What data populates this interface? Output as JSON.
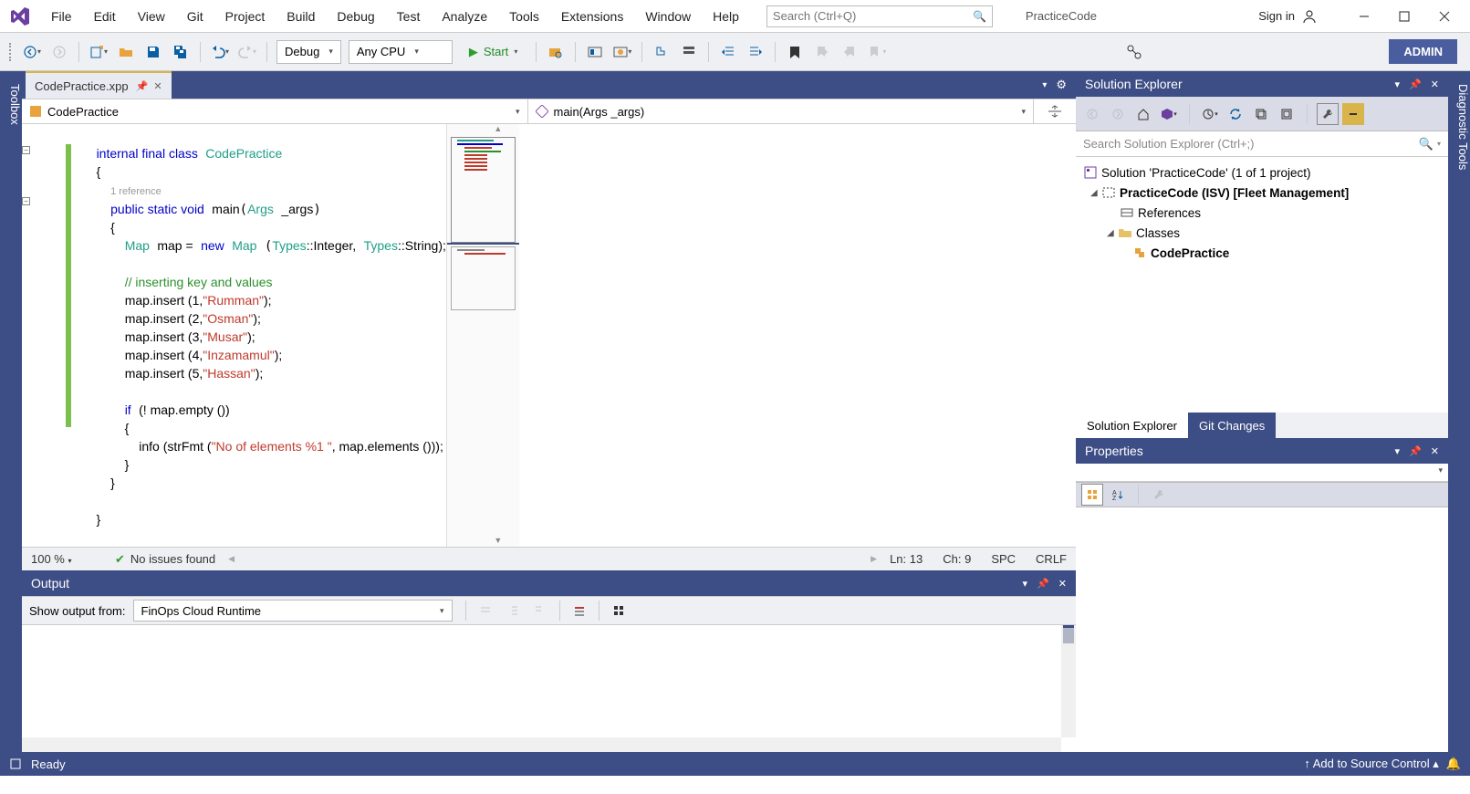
{
  "menu": {
    "items": [
      "File",
      "Edit",
      "View",
      "Git",
      "Project",
      "Build",
      "Debug",
      "Test",
      "Analyze",
      "Tools",
      "Extensions",
      "Window",
      "Help"
    ]
  },
  "search": {
    "placeholder": "Search (Ctrl+Q)"
  },
  "app_title": "PracticeCode",
  "signin": "Sign in",
  "toolbar": {
    "config": "Debug",
    "platform": "Any CPU",
    "start": "Start",
    "admin": "ADMIN"
  },
  "left_rail": "Toolbox",
  "right_rail": "Diagnostic Tools",
  "tab": {
    "name": "CodePractice.xpp"
  },
  "nav": {
    "left": "CodePractice",
    "right": "main(Args _args)"
  },
  "code": {
    "ref_lens": "1 reference",
    "lines": {
      "l1_a": "internal final class",
      "l1_b": "CodePractice",
      "l3_a": "public static void",
      "l3_b": "main",
      "l3_c": "Args",
      "l3_d": "_args",
      "l5_a": "Map",
      "l5_b": "map =",
      "l5_c": "new",
      "l5_d": "Map",
      "l5_e": "Types",
      "l5_f": "::Integer,",
      "l5_g": "Types",
      "l5_h": "::String);",
      "cmt": "// inserting key and values",
      "i1_a": "map.insert (1,",
      "i1_b": "\"Rumman\"",
      "i1_c": ");",
      "i2_a": "map.insert (2,",
      "i2_b": "\"Osman\"",
      "i2_c": ");",
      "i3_a": "map.insert (3,",
      "i3_b": "\"Musar\"",
      "i3_c": ");",
      "i4_a": "map.insert (4,",
      "i4_b": "\"Inzamamul\"",
      "i4_c": ");",
      "i5_a": "map.insert (5,",
      "i5_b": "\"Hassan\"",
      "i5_c": ");",
      "if_a": "if",
      "if_b": "(! map.empty ())",
      "info_a": "info (strFmt (",
      "info_b": "\"No of elements %1 \"",
      "info_c": ", map.elements ()));"
    }
  },
  "code_status": {
    "zoom": "100 %",
    "issues": "No issues found",
    "ln": "Ln: 13",
    "ch": "Ch: 9",
    "ws": "SPC",
    "eol": "CRLF"
  },
  "output": {
    "title": "Output",
    "from_label": "Show output from:",
    "from": "FinOps Cloud Runtime"
  },
  "solution": {
    "title": "Solution Explorer",
    "search_placeholder": "Search Solution Explorer (Ctrl+;)",
    "root": "Solution 'PracticeCode' (1 of 1 project)",
    "project": "PracticeCode (ISV) [Fleet Management]",
    "refs": "References",
    "classes": "Classes",
    "class1": "CodePractice",
    "tab1": "Solution Explorer",
    "tab2": "Git Changes"
  },
  "properties": {
    "title": "Properties"
  },
  "status": {
    "ready": "Ready",
    "source_control": "Add to Source Control"
  }
}
